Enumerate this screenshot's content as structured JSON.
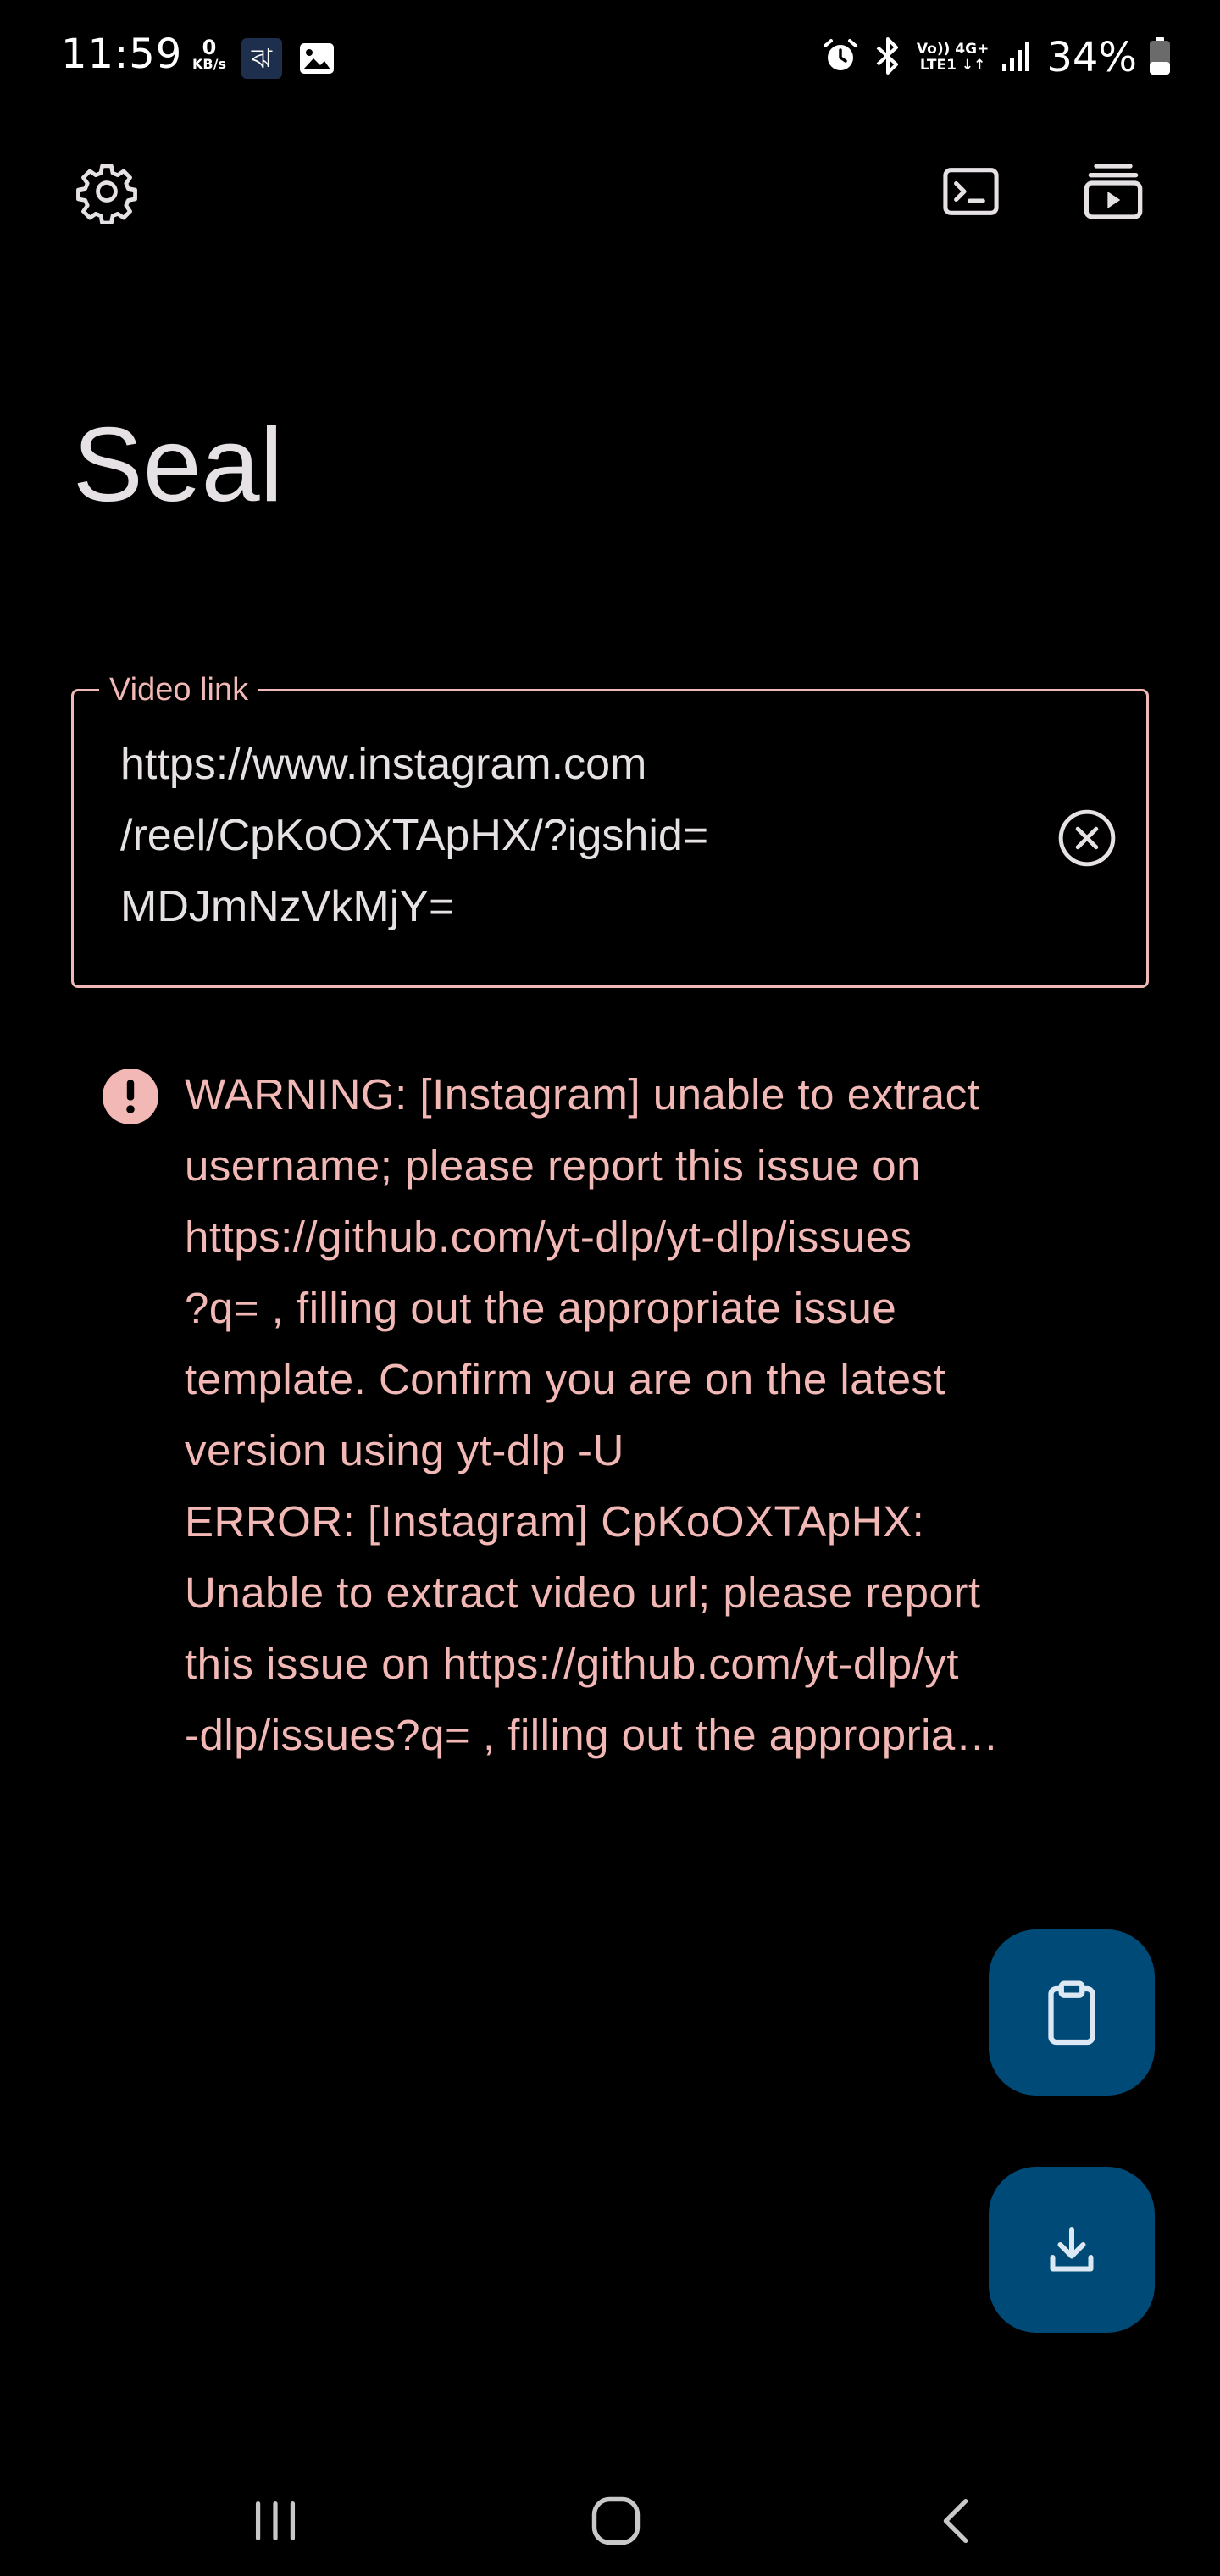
{
  "status_bar": {
    "time": "11:59",
    "net_speed_value": "0",
    "net_speed_unit": "KB/s",
    "app_notification_glyph": "ঝ",
    "network_top": "Vo)) 4G+",
    "network_bottom": "LTE1 ↓↑",
    "battery": "34%",
    "icons": [
      "alarm-icon",
      "bluetooth-icon",
      "signal-icon",
      "battery-icon",
      "gallery-icon"
    ]
  },
  "toolbar": {
    "icons": [
      "gear-icon",
      "terminal-icon",
      "download-queue-icon"
    ]
  },
  "app": {
    "title": "Seal"
  },
  "url_field": {
    "label": "Video link",
    "lines": [
      "https://www.instagram.com",
      "/reel/CpKoOXTApHX/?igshid=",
      "MDJmNzVkMjY="
    ],
    "clear_icon": "clear-circle-icon"
  },
  "error": {
    "icon": "error-icon",
    "lines": [
      "WARNING: [Instagram] unable to extract",
      "username; please report this issue on",
      "https://github.com/yt-dlp/yt-dlp/issues",
      "?q= , filling out the appropriate issue",
      "template. Confirm you are on the latest",
      "version using  yt-dlp -U",
      "ERROR: [Instagram] CpKoOXTApHX:",
      "Unable to extract video url; please report",
      "this issue on  https://github.com/yt-dlp/yt",
      "-dlp/issues?q= , filling out the appropria…"
    ]
  },
  "fabs": {
    "paste_icon": "clipboard-icon",
    "download_icon": "download-icon"
  },
  "nav": {
    "icons": [
      "recents-icon",
      "home-icon",
      "back-icon"
    ]
  },
  "colors": {
    "background": "#000000",
    "error": "#f2b8b5",
    "fab": "#004a77",
    "on_surface": "#e6e1e5"
  }
}
